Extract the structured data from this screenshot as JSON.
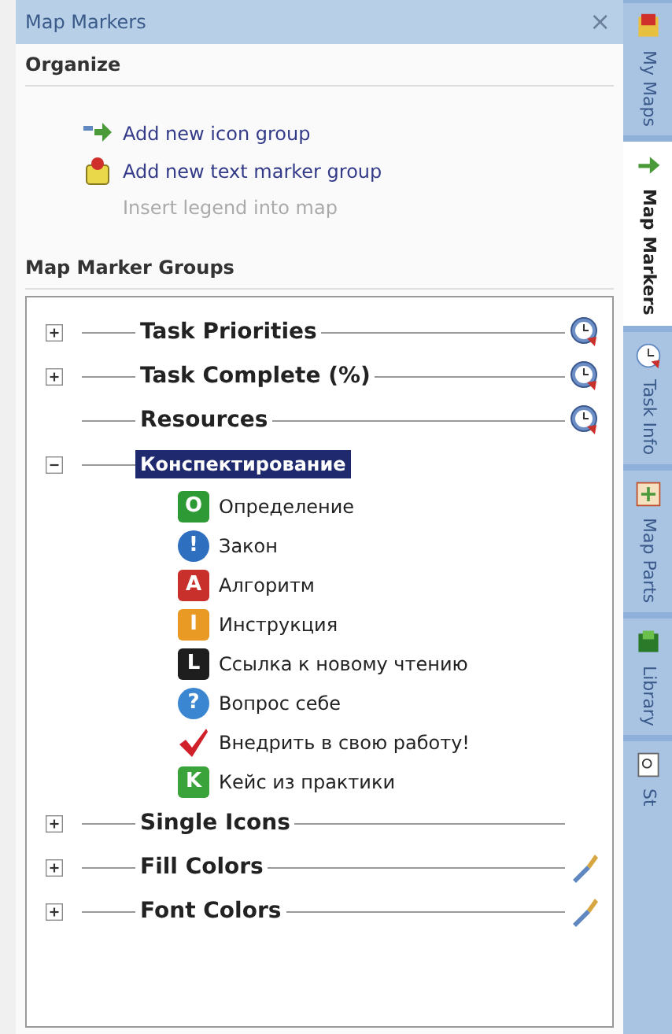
{
  "panel": {
    "title": "Map Markers",
    "close": "×"
  },
  "organize": {
    "heading": "Organize",
    "actions": [
      {
        "label": "Add new icon group",
        "kind": "icon-group",
        "disabled": false
      },
      {
        "label": "Add new text marker group",
        "kind": "text-group",
        "disabled": false
      },
      {
        "label": "Insert legend into map",
        "kind": "legend",
        "disabled": true
      }
    ]
  },
  "groups_heading": "Map Marker Groups",
  "groups": [
    {
      "name": "Task Priorities",
      "expanded": false,
      "selected": false,
      "kind": "clock"
    },
    {
      "name": "Task Complete (%)",
      "expanded": false,
      "selected": false,
      "kind": "clock"
    },
    {
      "name": "Resources",
      "kind": "clock",
      "selected": false
    },
    {
      "name": "Конспектирование",
      "expanded": true,
      "selected": true,
      "children": [
        {
          "label": "Определение",
          "kind": "letter",
          "glyph": "O",
          "color": "#2e9a35"
        },
        {
          "label": "Закон",
          "kind": "bubble",
          "glyph": "!",
          "color": "#2f6fc0"
        },
        {
          "label": "Алгоритм",
          "kind": "letter",
          "glyph": "A",
          "color": "#c8302c"
        },
        {
          "label": "Инструкция",
          "kind": "letter",
          "glyph": "I",
          "color": "#e89a25"
        },
        {
          "label": "Ссылка к новому чтению",
          "kind": "letter",
          "glyph": "L",
          "color": "#1e1e1e"
        },
        {
          "label": "Вопрос себе",
          "kind": "bubble",
          "glyph": "?",
          "color": "#3a86d0"
        },
        {
          "label": "Внедрить в свою работу!",
          "kind": "check",
          "color": "#d0202a"
        },
        {
          "label": "Кейс из практики",
          "kind": "letter",
          "glyph": "K",
          "color": "#3aa33a"
        }
      ]
    },
    {
      "name": "Single Icons",
      "expanded": false,
      "selected": false
    },
    {
      "name": "Fill Colors",
      "expanded": false,
      "selected": false,
      "kind": "brush"
    },
    {
      "name": "Font Colors",
      "expanded": false,
      "selected": false,
      "kind": "brush"
    }
  ],
  "side_tabs": [
    {
      "label": "My Maps",
      "selected": false,
      "kind": "maps"
    },
    {
      "label": "Map Markers",
      "selected": true,
      "kind": "markers"
    },
    {
      "label": "Task Info",
      "selected": false,
      "kind": "clock"
    },
    {
      "label": "Map Parts",
      "selected": false,
      "kind": "parts"
    },
    {
      "label": "Library",
      "selected": false,
      "kind": "library"
    },
    {
      "label": "St",
      "selected": false,
      "kind": "search"
    }
  ]
}
